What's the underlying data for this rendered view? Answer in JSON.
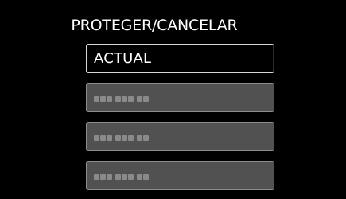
{
  "menu": {
    "title": "PROTEGER/CANCELAR",
    "options": [
      {
        "label": "ACTUAL",
        "state": "selected"
      },
      {
        "label": "",
        "state": "placeholder"
      },
      {
        "label": "",
        "state": "placeholder"
      },
      {
        "label": "",
        "state": "placeholder"
      }
    ]
  },
  "colors": {
    "background": "#000000",
    "option_fill": "#515151",
    "option_border": "#8c8c8c",
    "selected_border": "#d8d8d8",
    "text": "#ffffff",
    "placeholder_block": "#8a8a8a"
  }
}
